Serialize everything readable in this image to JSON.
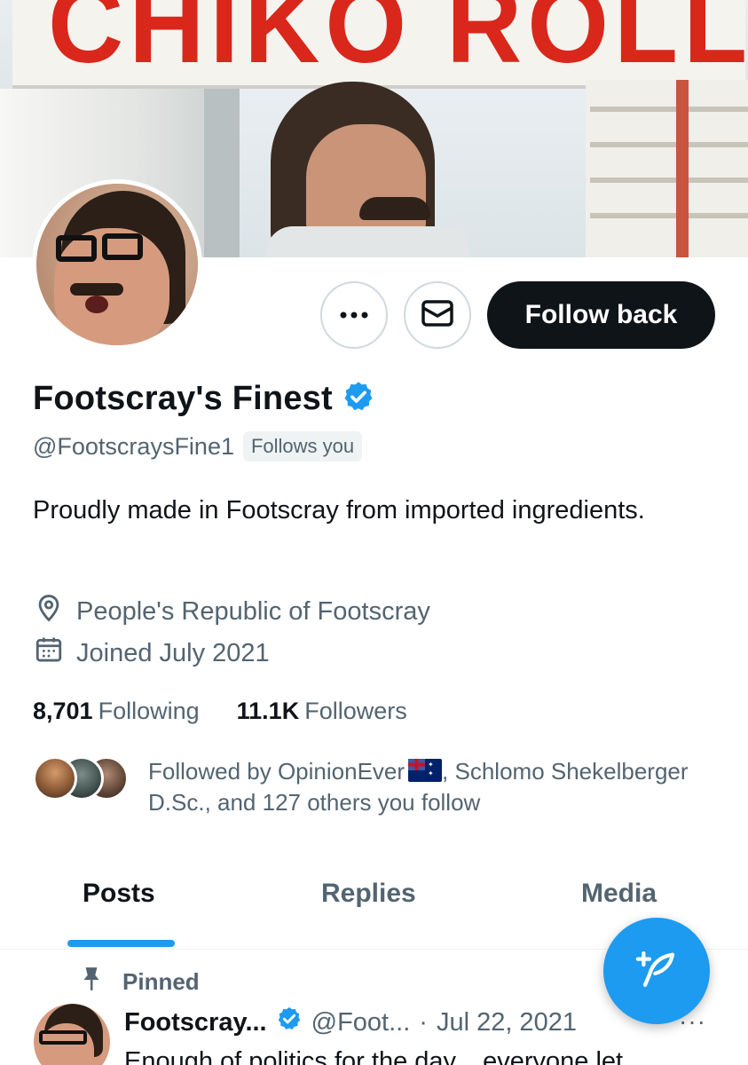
{
  "banner": {
    "sign_text": "CHIKO ROLLS"
  },
  "profile": {
    "display_name": "Footscray's Finest",
    "handle": "@FootscraysFine1",
    "follows_you": "Follows you",
    "bio": "Proudly made in Footscray from imported ingredients.",
    "location": "People's Republic of Footscray",
    "joined": "Joined July 2021",
    "following_count": "8,701",
    "following_label": "Following",
    "followers_count": "11.1K",
    "followers_label": "Followers",
    "followed_by_prefix": "Followed by OpinionEver",
    "followed_by_suffix": ", Schlomo Shekelberger D.Sc., and 127 others you follow"
  },
  "actions": {
    "more_icon": "more-dots-icon",
    "message_icon": "envelope-icon",
    "follow_back_label": "Follow back"
  },
  "tabs": [
    {
      "label": "Posts",
      "active": true
    },
    {
      "label": "Replies",
      "active": false
    },
    {
      "label": "Media",
      "active": false
    }
  ],
  "pinned_tweet": {
    "pinned_label": "Pinned",
    "author_name": "Footscray...",
    "author_handle": "@Foot...",
    "separator": "·",
    "date": "Jul 22, 2021",
    "more": "···",
    "text": "Enough of politics for the day... everyone let"
  },
  "colors": {
    "accent": "#1d9bf0",
    "text_primary": "#0f1419",
    "text_secondary": "#536471",
    "follow_button": "#0f1419"
  }
}
